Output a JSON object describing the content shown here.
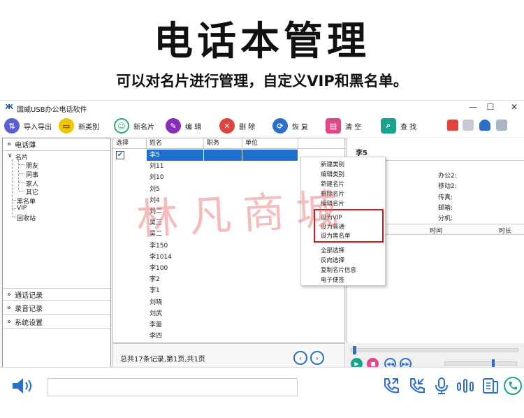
{
  "hero": {
    "title": "电话本管理",
    "subtitle": "可以对名片进行管理，自定义VIP和黑名单。"
  },
  "window": {
    "logo": "Ж",
    "title": "国威USB办公电话软件",
    "controls": [
      "—",
      "☐",
      "✕"
    ]
  },
  "toolbar": {
    "buttons": [
      {
        "label": "导入导出",
        "icon": "import-export-icon",
        "color": "#5b5fd6",
        "glyph": "⇅"
      },
      {
        "label": "新类别",
        "icon": "new-category-icon",
        "color": "#f2c400",
        "glyph": "▭"
      },
      {
        "label": "新名片",
        "icon": "new-card-icon",
        "color": "#2aa870",
        "glyph": "☺"
      },
      {
        "label": "编 辑",
        "icon": "edit-icon",
        "color": "#8a2db8",
        "glyph": "✎"
      },
      {
        "label": "删 除",
        "icon": "delete-icon",
        "color": "#e2433e",
        "glyph": "✕"
      },
      {
        "label": "恢 复",
        "icon": "restore-icon",
        "color": "#2b6fc9",
        "glyph": "⟳"
      },
      {
        "label": "清 空",
        "icon": "clear-icon",
        "color": "#e0488a",
        "glyph": "▤"
      },
      {
        "label": "查 找",
        "icon": "search-icon",
        "color": "#1aa38b",
        "glyph": "⌕"
      }
    ]
  },
  "left": {
    "phonebook": "电话薄",
    "tree": {
      "root": "名片",
      "children": [
        "朋友",
        "同事",
        "家人",
        "其它"
      ],
      "others": [
        "黑名单",
        "VIP",
        "回收站"
      ]
    },
    "sections": [
      "通话记录",
      "录音记录",
      "系统设置"
    ]
  },
  "table": {
    "columns": [
      "选择",
      "姓名",
      "职务",
      "单位"
    ],
    "rows": [
      "李5",
      "刘11",
      "刘10",
      "刘5",
      "刘4",
      "刘二",
      "吴三",
      "吴二",
      "李150",
      "李1014",
      "李100",
      "李2",
      "李1",
      "刘晓",
      "刘武",
      "李量",
      "李四"
    ],
    "selected_row": 0
  },
  "pager": {
    "summary": "总共17条记录,第1页,共1页",
    "prev": "‹",
    "next": "›"
  },
  "detail": {
    "name": "李5",
    "labels": [
      "办公2:",
      "移动2:",
      "传真:",
      "邮箱:",
      "分机:"
    ],
    "columns": [
      "时间",
      "时长"
    ]
  },
  "context_menu": {
    "group1": [
      "新建类别",
      "编辑类别",
      "新建名片",
      "删除名片",
      "编辑名片"
    ],
    "group2": [
      "设为VIP",
      "设为普通",
      "设为黑名单"
    ],
    "group3": [
      "全部选择",
      "反向选择",
      "复制名片信息",
      "电子便签"
    ]
  },
  "watermark": "林凡商城",
  "colors": {
    "accent": "#2b6fc9",
    "selection": "#1f6fd0",
    "highlight_box": "#d8161b",
    "watermark": "#e86060"
  }
}
